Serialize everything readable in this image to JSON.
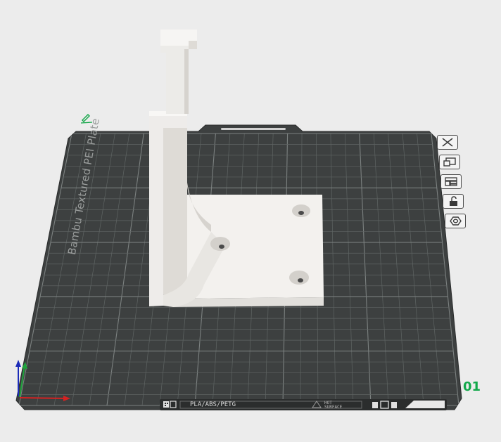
{
  "plate": {
    "name": "Bambu Textured PEI Plate",
    "number": "01"
  },
  "bed_strip": {
    "materials": "PLA/ABS/PETG",
    "warning_line1": "HOT",
    "warning_line2": "SURFACE"
  },
  "toolbar": {
    "icons": [
      "close-icon",
      "auto-orient-icon",
      "arrange-icon",
      "lock-icon",
      "settings-icon"
    ]
  },
  "colors": {
    "plate": "#3d4040",
    "grid": "#6b706f",
    "model": "#f5f3f0",
    "plate_number": "#12a84a",
    "axis_x": "#d42222",
    "axis_y": "#1fa33c",
    "axis_z": "#1b2bb8"
  }
}
